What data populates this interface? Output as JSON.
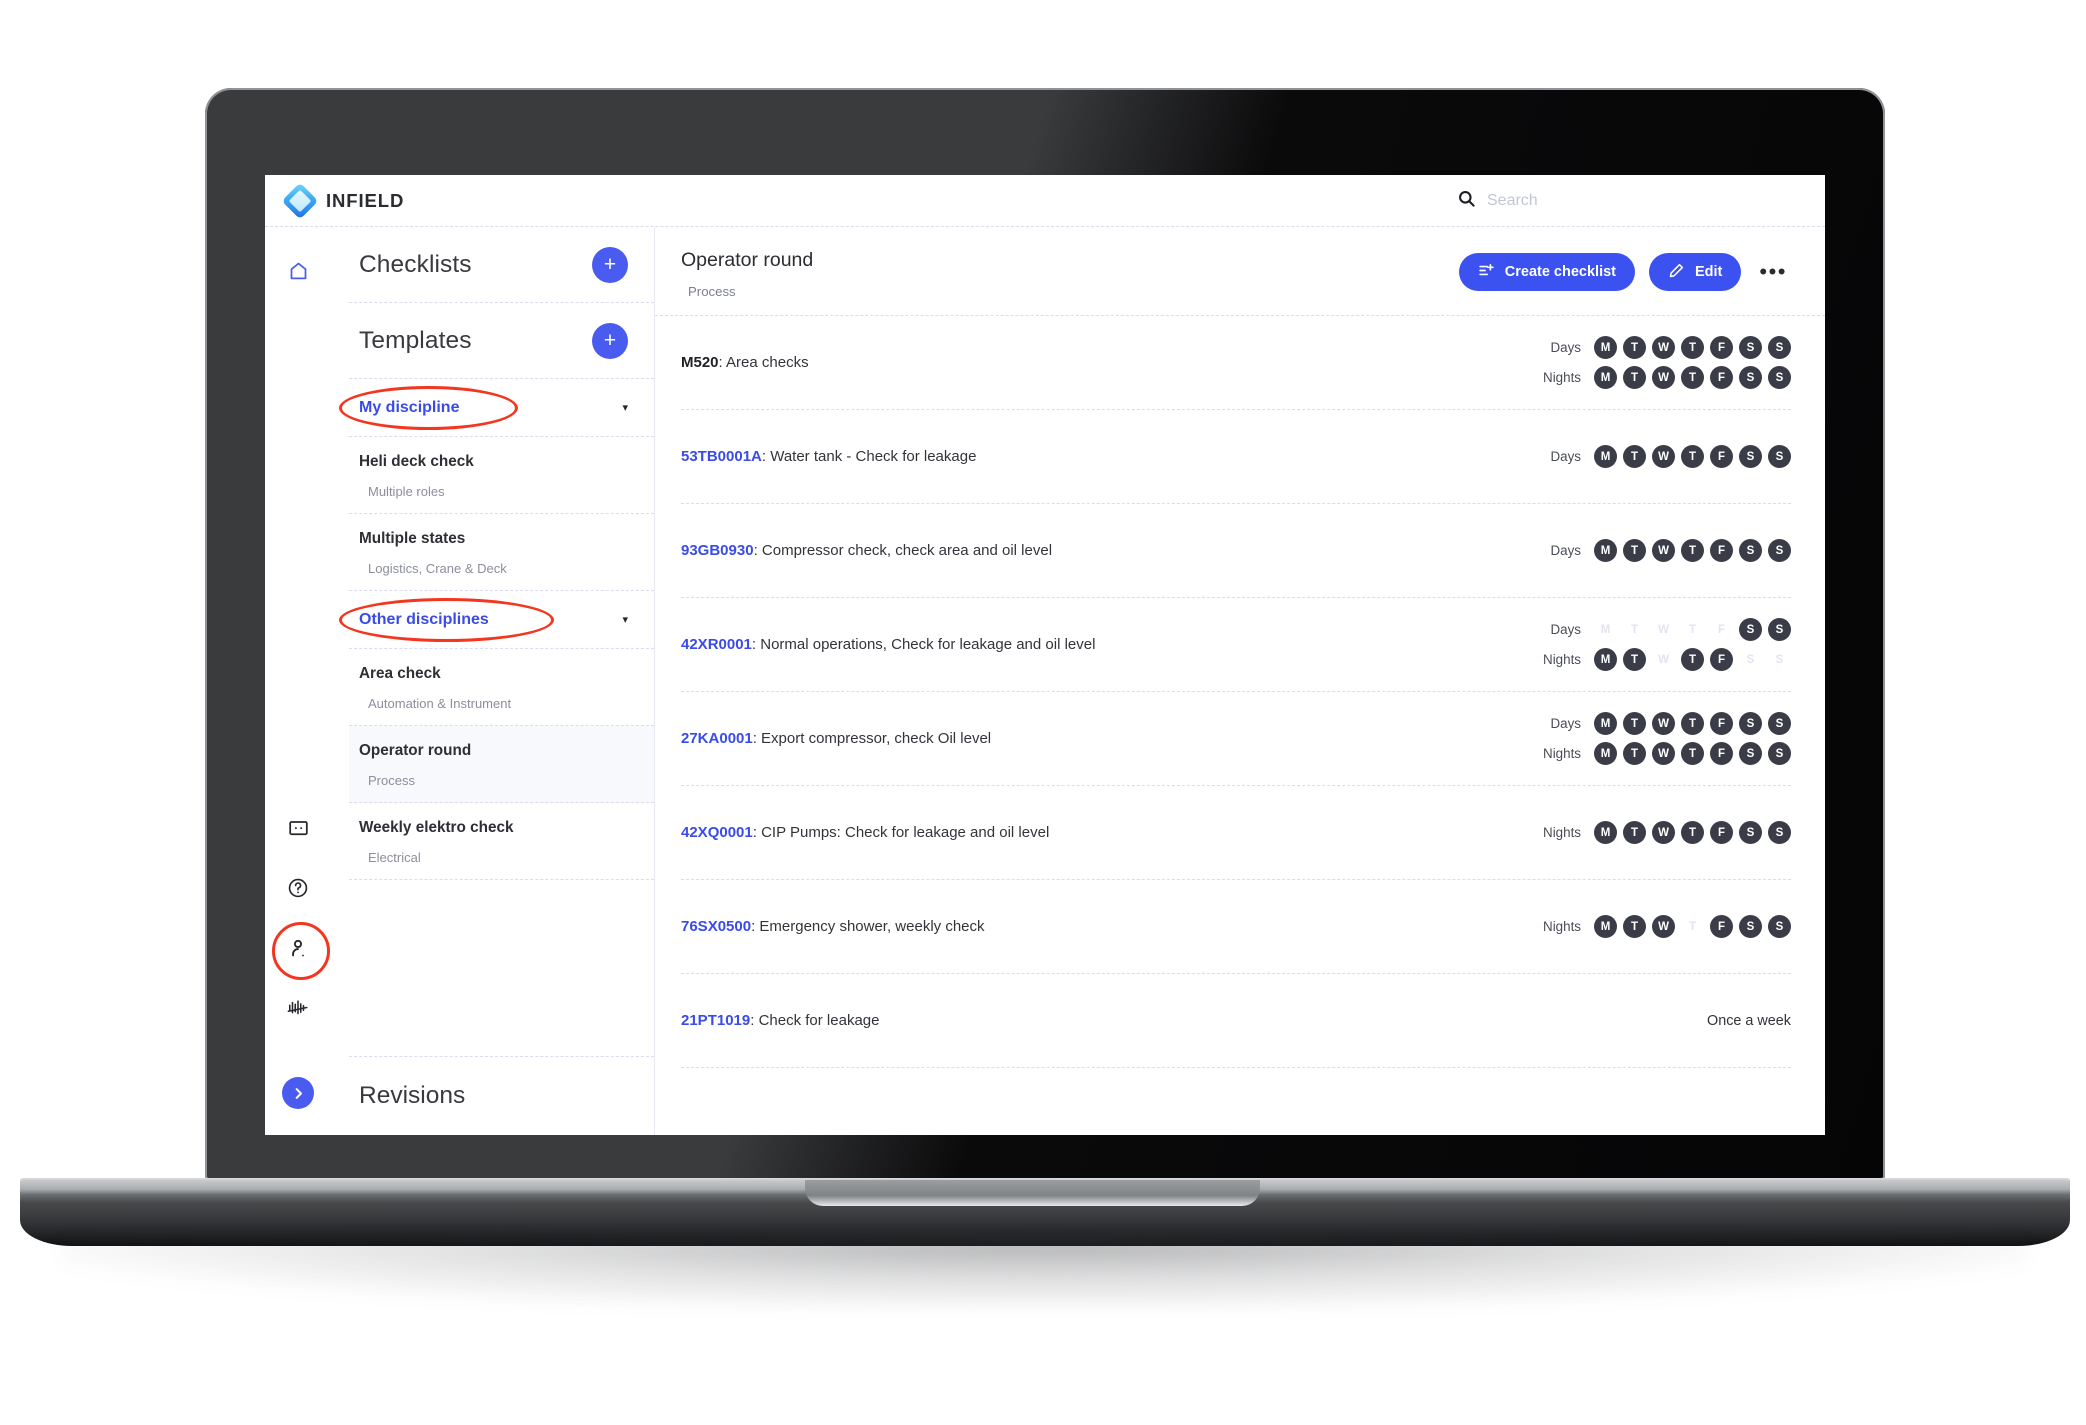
{
  "app": {
    "brand_name": "INFIELD",
    "logo_icon": "diamond-logo-icon"
  },
  "search": {
    "placeholder": "Search",
    "value": "",
    "icon": "search-icon"
  },
  "rail": {
    "home_icon": "home-icon",
    "chat_icon": "chat-bubble-icon",
    "help_icon": "help-circle-icon",
    "profile_icon": "person-icon",
    "analytics_icon": "analytics-bars-icon",
    "collapse_icon": "chevron-right-icon"
  },
  "sidebar": {
    "checklists": {
      "title": "Checklists",
      "add_label": "+"
    },
    "templates": {
      "title": "Templates",
      "add_label": "+"
    },
    "groups": [
      {
        "label": "My discipline",
        "caret": "▾",
        "annotated": true,
        "items": [
          {
            "name": "Heli deck check",
            "sub": "Multiple roles",
            "selected": false
          },
          {
            "name": "Multiple states",
            "sub": "Logistics, Crane & Deck",
            "selected": false
          }
        ]
      },
      {
        "label": "Other disciplines",
        "caret": "▾",
        "annotated": true,
        "items": [
          {
            "name": "Area check",
            "sub": "Automation & Instrument",
            "selected": false
          },
          {
            "name": "Operator round",
            "sub": "Process",
            "selected": true
          },
          {
            "name": "Weekly elektro check",
            "sub": "Electrical",
            "selected": false
          }
        ]
      }
    ],
    "revisions": {
      "title": "Revisions"
    }
  },
  "main": {
    "title": "Operator round",
    "subtitle": "Process",
    "create_checklist_label": "Create checklist",
    "create_checklist_icon": "list-plus-icon",
    "edit_label": "Edit",
    "edit_icon": "pencil-icon",
    "more_label": "•••",
    "more_icon": "ellipsis-icon",
    "day_letters": [
      "M",
      "T",
      "W",
      "T",
      "F",
      "S",
      "S"
    ],
    "days_label": "Days",
    "nights_label": "Nights",
    "tasks": [
      {
        "tag": "M520",
        "tag_is_link": false,
        "text": ": Area checks",
        "schedule": [
          {
            "label": "Days",
            "active": [
              true,
              true,
              true,
              true,
              true,
              true,
              true
            ]
          },
          {
            "label": "Nights",
            "active": [
              true,
              true,
              true,
              true,
              true,
              true,
              true
            ]
          }
        ]
      },
      {
        "tag": "53TB0001A",
        "tag_is_link": true,
        "text": ": Water tank - Check for leakage",
        "schedule": [
          {
            "label": "Days",
            "active": [
              true,
              true,
              true,
              true,
              true,
              true,
              true
            ]
          }
        ]
      },
      {
        "tag": "93GB0930",
        "tag_is_link": true,
        "text": ": Compressor check, check area and oil level",
        "schedule": [
          {
            "label": "Days",
            "active": [
              true,
              true,
              true,
              true,
              true,
              true,
              true
            ]
          }
        ]
      },
      {
        "tag": "42XR0001",
        "tag_is_link": true,
        "text": ": Normal operations, Check for leakage and oil level",
        "schedule": [
          {
            "label": "Days",
            "active": [
              false,
              false,
              false,
              false,
              false,
              true,
              true
            ]
          },
          {
            "label": "Nights",
            "active": [
              true,
              true,
              false,
              true,
              true,
              false,
              false
            ]
          }
        ]
      },
      {
        "tag": "27KA0001",
        "tag_is_link": true,
        "text": ": Export compressor, check Oil level",
        "schedule": [
          {
            "label": "Days",
            "active": [
              true,
              true,
              true,
              true,
              true,
              true,
              true
            ]
          },
          {
            "label": "Nights",
            "active": [
              true,
              true,
              true,
              true,
              true,
              true,
              true
            ]
          }
        ]
      },
      {
        "tag": "42XQ0001",
        "tag_is_link": true,
        "text": ": CIP Pumps: Check for leakage and oil level",
        "schedule": [
          {
            "label": "Nights",
            "active": [
              true,
              true,
              true,
              true,
              true,
              true,
              true
            ]
          }
        ]
      },
      {
        "tag": "76SX0500",
        "tag_is_link": true,
        "text": ": Emergency shower, weekly check",
        "schedule": [
          {
            "label": "Nights",
            "active": [
              true,
              true,
              true,
              false,
              true,
              true,
              true
            ]
          }
        ]
      },
      {
        "tag": "21PT1019",
        "tag_is_link": true,
        "text": ": Check for leakage",
        "once_text": "Once a week",
        "schedule": []
      }
    ]
  },
  "annotations": {
    "highlight_color": "#f2361f",
    "accent_color": "#3c52f0",
    "link_color": "#3a4be8"
  }
}
